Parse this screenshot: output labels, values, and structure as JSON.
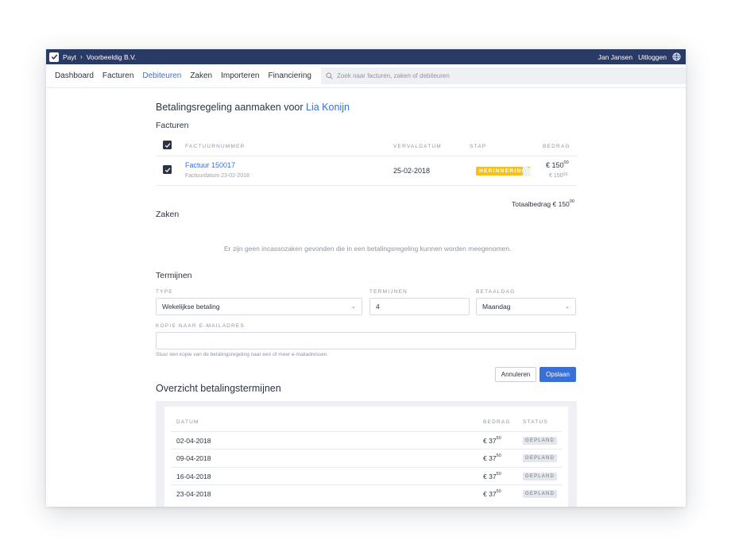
{
  "topbar": {
    "app_name": "Payt",
    "separator": "›",
    "company": "Voorbeeldig B.V.",
    "user": "Jan Jansen",
    "logout": "Uitloggen",
    "icons": [
      "check-logo-icon",
      "globe-icon"
    ]
  },
  "nav": {
    "items": [
      {
        "label": "Dashboard"
      },
      {
        "label": "Facturen"
      },
      {
        "label": "Debiteuren"
      },
      {
        "label": "Zaken"
      },
      {
        "label": "Importeren"
      },
      {
        "label": "Financiering"
      }
    ],
    "active": "Debiteuren",
    "search_placeholder": "Zoek naar facturen, zaken of debiteuren"
  },
  "page": {
    "title_prefix": "Betalingsregeling aanmaken voor",
    "debtor_name": "Lia Konijn"
  },
  "invoices": {
    "heading": "Facturen",
    "columns": {
      "number": "FACTUURNUMMER",
      "due_date": "VERVALDATUM",
      "step": "STAP",
      "amount": "BEDRAG"
    },
    "rows": [
      {
        "checked": true,
        "number": "Factuur 150017",
        "invoice_date": "Factuurdatum 23-02-2018",
        "due_date": "25-02-2018",
        "step": "HERINNERING",
        "amount_main": "€ 150",
        "amount_cents": "00",
        "amount_sub_main": "€ 150",
        "amount_sub_cents": "00"
      }
    ],
    "total_label": "Totaalbedrag € 150",
    "total_cents": "00"
  },
  "cases": {
    "heading": "Zaken",
    "empty_message": "Er zijn geen incassozaken gevonden die in een betalingsregeling kunnen worden meegenomen."
  },
  "terms": {
    "heading": "Termijnen",
    "type_label": "TYPE",
    "type_value": "Wekelijkse betaling",
    "count_label": "TERMIJNEN",
    "count_value": "4",
    "payday_label": "BETAALDAG",
    "payday_value": "Maandag",
    "email_label": "KOPIE NAAR E-MAILADRES",
    "email_value": "",
    "email_help": "Stuur een kopie van de betalingsregeling naar een of meer e-mailadressen.",
    "cancel_label": "Annuleren",
    "save_label": "Opslaan"
  },
  "overview": {
    "heading": "Overzicht betalingstermijnen",
    "columns": {
      "date": "DATUM",
      "amount": "BEDRAG",
      "status": "STATUS"
    },
    "rows": [
      {
        "date": "02-04-2018",
        "amount_main": "€ 37",
        "amount_cents": "50",
        "status": "GEPLAND"
      },
      {
        "date": "09-04-2018",
        "amount_main": "€ 37",
        "amount_cents": "50",
        "status": "GEPLAND"
      },
      {
        "date": "16-04-2018",
        "amount_main": "€ 37",
        "amount_cents": "50",
        "status": "GEPLAND"
      },
      {
        "date": "23-04-2018",
        "amount_main": "€ 37",
        "amount_cents": "50",
        "status": "GEPLAND"
      }
    ]
  },
  "colors": {
    "topbar": "#2a3a66",
    "accent": "#3a6fd8",
    "warning_badge": "#f5c21b"
  }
}
